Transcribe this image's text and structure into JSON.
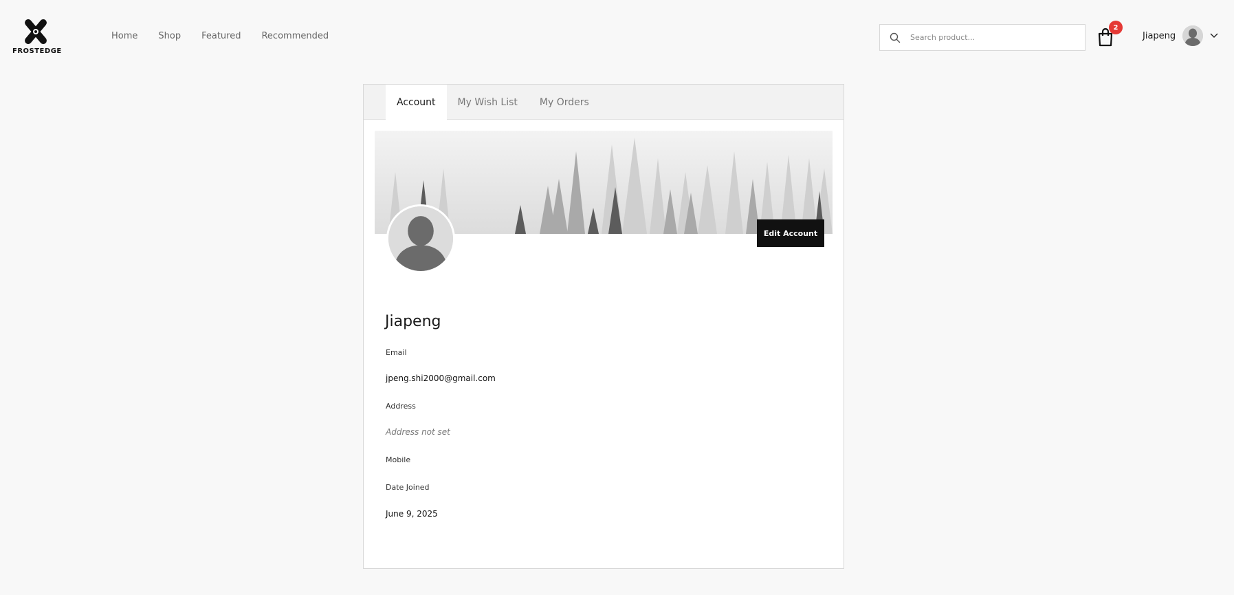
{
  "brand": {
    "name": "FROSTEDGE"
  },
  "nav": [
    {
      "label": "Home"
    },
    {
      "label": "Shop"
    },
    {
      "label": "Featured"
    },
    {
      "label": "Recommended"
    }
  ],
  "search": {
    "placeholder": "Search product...",
    "value": ""
  },
  "cart": {
    "count": "2"
  },
  "user": {
    "name": "Jiapeng"
  },
  "tabs": [
    {
      "label": "Account",
      "active": true
    },
    {
      "label": "My Wish List",
      "active": false
    },
    {
      "label": "My Orders",
      "active": false
    }
  ],
  "profile": {
    "edit_label": "Edit Account",
    "name": "Jiapeng",
    "email_label": "Email",
    "email": "jpeng.shi2000@gmail.com",
    "address_label": "Address",
    "address": "Address not set",
    "mobile_label": "Mobile",
    "date_label": "Date Joined",
    "date_joined": "June 9, 2025"
  },
  "colors": {
    "badge": "#e53935",
    "button": "#111111",
    "tab_bar": "#f2f2f2"
  },
  "icons": [
    "frostedge-logo-icon",
    "search-icon",
    "shopping-bag-icon",
    "chevron-down-icon",
    "avatar-silhouette-icon"
  ]
}
